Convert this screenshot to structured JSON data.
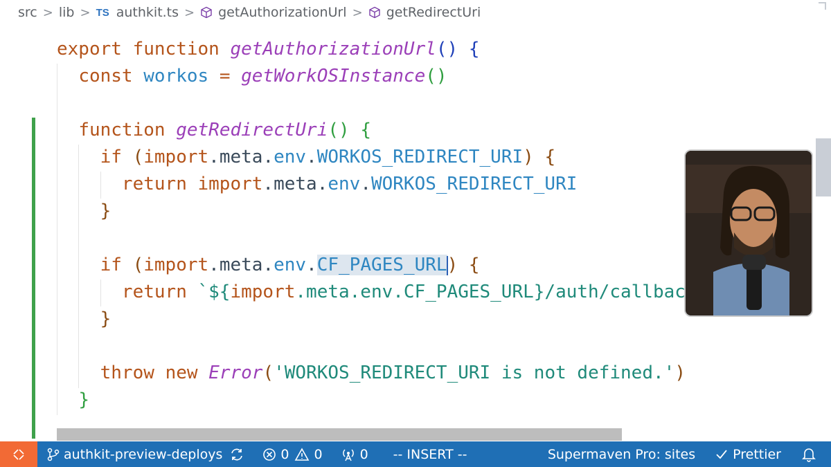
{
  "breadcrumb": {
    "items": [
      "src",
      "lib",
      "authkit.ts",
      "getAuthorizationUrl",
      "getRedirectUri"
    ],
    "file_badge": "TS",
    "separator": ">"
  },
  "code": {
    "lines": [
      [
        [
          "kw",
          "export"
        ],
        [
          "t",
          " "
        ],
        [
          "kw",
          "function"
        ],
        [
          "t",
          " "
        ],
        [
          "fn",
          "getAuthorizationUrl"
        ],
        [
          "p1",
          "()"
        ],
        [
          "t",
          " "
        ],
        [
          "p1",
          "{"
        ]
      ],
      [
        [
          "t",
          "  "
        ],
        [
          "kw",
          "const"
        ],
        [
          "t",
          " "
        ],
        [
          "var",
          "workos"
        ],
        [
          "t",
          " "
        ],
        [
          "op",
          "="
        ],
        [
          "t",
          " "
        ],
        [
          "fn",
          "getWorkOSInstance"
        ],
        [
          "p2",
          "()"
        ]
      ],
      [],
      [
        [
          "t",
          "  "
        ],
        [
          "kw",
          "function"
        ],
        [
          "t",
          " "
        ],
        [
          "fn",
          "getRedirectUri"
        ],
        [
          "p2",
          "()"
        ],
        [
          "t",
          " "
        ],
        [
          "p2",
          "{"
        ]
      ],
      [
        [
          "t",
          "    "
        ],
        [
          "kw",
          "if"
        ],
        [
          "t",
          " "
        ],
        [
          "p3",
          "("
        ],
        [
          "kw",
          "import"
        ],
        [
          "mem",
          ".meta."
        ],
        [
          "var",
          "env"
        ],
        [
          "mem",
          "."
        ],
        [
          "const",
          "WORKOS_REDIRECT_URI"
        ],
        [
          "p3",
          ")"
        ],
        [
          "t",
          " "
        ],
        [
          "p3",
          "{"
        ]
      ],
      [
        [
          "t",
          "      "
        ],
        [
          "kw",
          "return"
        ],
        [
          "t",
          " "
        ],
        [
          "kw",
          "import"
        ],
        [
          "mem",
          ".meta."
        ],
        [
          "var",
          "env"
        ],
        [
          "mem",
          "."
        ],
        [
          "const",
          "WORKOS_REDIRECT_URI"
        ]
      ],
      [
        [
          "t",
          "    "
        ],
        [
          "p3",
          "}"
        ]
      ],
      [],
      [
        [
          "t",
          "    "
        ],
        [
          "kw",
          "if"
        ],
        [
          "t",
          " "
        ],
        [
          "p3",
          "("
        ],
        [
          "kw",
          "import"
        ],
        [
          "mem",
          ".meta."
        ],
        [
          "var",
          "env"
        ],
        [
          "mem",
          "."
        ],
        [
          "selconst",
          "CF_PAGES_URL"
        ],
        [
          "cursor",
          ""
        ],
        [
          "p3",
          ")"
        ],
        [
          "t",
          " "
        ],
        [
          "p3",
          "{"
        ]
      ],
      [
        [
          "t",
          "      "
        ],
        [
          "kw",
          "return"
        ],
        [
          "t",
          " "
        ],
        [
          "tpl",
          "`${"
        ],
        [
          "kw",
          "import"
        ],
        [
          "tpl",
          ".meta.env.CF_PAGES_URL}/auth/callback`"
        ]
      ],
      [
        [
          "t",
          "    "
        ],
        [
          "p3",
          "}"
        ]
      ],
      [],
      [
        [
          "t",
          "    "
        ],
        [
          "kw",
          "throw"
        ],
        [
          "t",
          " "
        ],
        [
          "kw",
          "new"
        ],
        [
          "t",
          " "
        ],
        [
          "cls",
          "Error"
        ],
        [
          "p3",
          "("
        ],
        [
          "str",
          "'WORKOS_REDIRECT_URI is not defined.'"
        ],
        [
          "p3",
          ")"
        ]
      ],
      [
        [
          "t",
          "  "
        ],
        [
          "p2",
          "}"
        ]
      ]
    ]
  },
  "statusbar": {
    "branch": "authkit-preview-deploys",
    "errors": "0",
    "warnings": "0",
    "ports": "0",
    "mode": "-- INSERT --",
    "supermaven": "Supermaven Pro: sites",
    "prettier": "Prettier"
  },
  "colors": {
    "keyword": "#b4541b",
    "function": "#9b3fb8",
    "variable": "#2e86c1",
    "string": "#1f8a7a",
    "statusbar": "#1f6fb5",
    "remote": "#f26a35",
    "gitbar": "#3fa14b"
  },
  "icons": [
    "cube-icon",
    "branch-icon",
    "sync-icon",
    "error-icon",
    "warning-icon",
    "broadcast-icon",
    "check-icon",
    "bell-icon",
    "remote-icon"
  ]
}
